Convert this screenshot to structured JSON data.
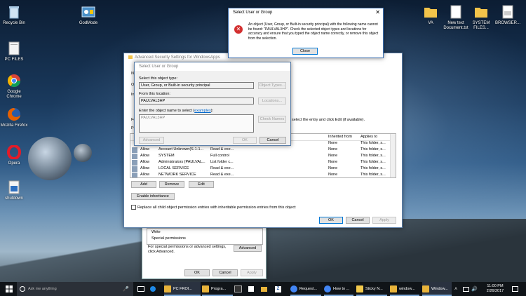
{
  "desktop": {
    "icons": [
      {
        "label": "Recycle Bin",
        "icon": "recycle-bin-icon"
      },
      {
        "label": "GodMode",
        "icon": "control-panel-icon"
      },
      {
        "label": "PC FILES",
        "icon": "folder-icon"
      },
      {
        "label": "Google Chrome",
        "icon": "chrome-icon"
      },
      {
        "label": "Mozilla Firefox",
        "icon": "firefox-icon"
      },
      {
        "label": "Opera",
        "icon": "opera-icon"
      },
      {
        "label": "shutdown",
        "icon": "shutdown-shortcut-icon"
      }
    ],
    "right_icons": [
      {
        "label": "VA",
        "icon": "folder-icon"
      },
      {
        "label": "New text Document.txt",
        "icon": "text-file-icon"
      },
      {
        "label": "SYSTEM FILES...",
        "icon": "folder-icon"
      },
      {
        "label": "BROWSER...",
        "icon": "bin-file-icon"
      }
    ]
  },
  "error_dialog": {
    "title": "Select User or Group",
    "message": "An object (User, Group, or Built-in security principal) with the following name cannot be found: \"PAULVAL3HP\". Check the selected object types and locations for accuracy and ensure that you typed the object name correctly, or remove this object from the selection.",
    "close_label": "Close"
  },
  "select_dialog": {
    "title": "Select User or Group",
    "object_type_label": "Select this object type:",
    "object_type_value": "User, Group, or Built-in security principal",
    "object_types_button": "Object Types...",
    "location_label": "From this location:",
    "location_value": "PAULVAL3HP",
    "locations_button": "Locations...",
    "enter_label": "Enter the object name to select (",
    "examples_link": "examples",
    "enter_label_end": "):",
    "object_name_value": "PAULVAL3HP",
    "check_names_button": "Check Names",
    "advanced_button": "Advanced",
    "ok_button": "OK",
    "cancel_button": "Cancel"
  },
  "adv_window": {
    "title": "Advanced Security Settings for WindowsApps",
    "partial_n": "N",
    "partial_o": "O",
    "partial_in": "In",
    "partial_fo": "Fo",
    "partial_pe": "Pe",
    "hint_text": ", select the entry and click Edit (if available).",
    "col_inherited": "Inherited from",
    "col_applies": "Applies to",
    "rows": [
      {
        "type": "",
        "principal": "",
        "access": "",
        "inherited": "None",
        "applies": "This folder, s..."
      },
      {
        "type": "Allow",
        "principal": "Account Unknown(S-1-1...",
        "access": "Read & exe...",
        "inherited": "None",
        "applies": "This folder, s..."
      },
      {
        "type": "Allow",
        "principal": "SYSTEM",
        "access": "Full control",
        "inherited": "None",
        "applies": "This folder, s..."
      },
      {
        "type": "Allow",
        "principal": "Administrators (PAULVAL...",
        "access": "List folder c...",
        "inherited": "None",
        "applies": "This folder, s..."
      },
      {
        "type": "Allow",
        "principal": "LOCAL SERVICE",
        "access": "Read & exe...",
        "inherited": "None",
        "applies": "This folder, s..."
      },
      {
        "type": "Allow",
        "principal": "NETWORK SERVICE",
        "access": "Read & exe...",
        "inherited": "None",
        "applies": "This folder, s..."
      }
    ],
    "add_button": "Add",
    "remove_button": "Remove",
    "edit_button": "Edit",
    "enable_inheritance_button": "Enable inheritance",
    "replace_checkbox_label": "Replace all child object permission entries with inheritable permission entries from this object",
    "ok_button": "OK",
    "cancel_button": "Cancel",
    "apply_button": "Apply"
  },
  "back_window": {
    "perm_items": [
      "Write",
      "Special permissions"
    ],
    "special_text": "For special permissions or advanced settings, click Advanced.",
    "advanced_button": "Advanced",
    "ok_button": "OK",
    "cancel_button": "Cancel",
    "apply_button": "Apply"
  },
  "taskbar": {
    "search_placeholder": "Ask me anything",
    "items": [
      {
        "label": "PC FROI...",
        "color": "#e8b33a"
      },
      {
        "label": "Progra...",
        "color": "#e8b33a"
      },
      {
        "label": "Request...",
        "color": "#4285f4"
      },
      {
        "label": "How to ...",
        "color": "#4285f4"
      },
      {
        "label": "Sticky N...",
        "color": "#f2c94c"
      },
      {
        "label": "window...",
        "color": "#e8b33a"
      },
      {
        "label": "Window...",
        "color": "#e8b33a"
      }
    ],
    "time": "11:00 PM",
    "date": "2/26/2017"
  }
}
